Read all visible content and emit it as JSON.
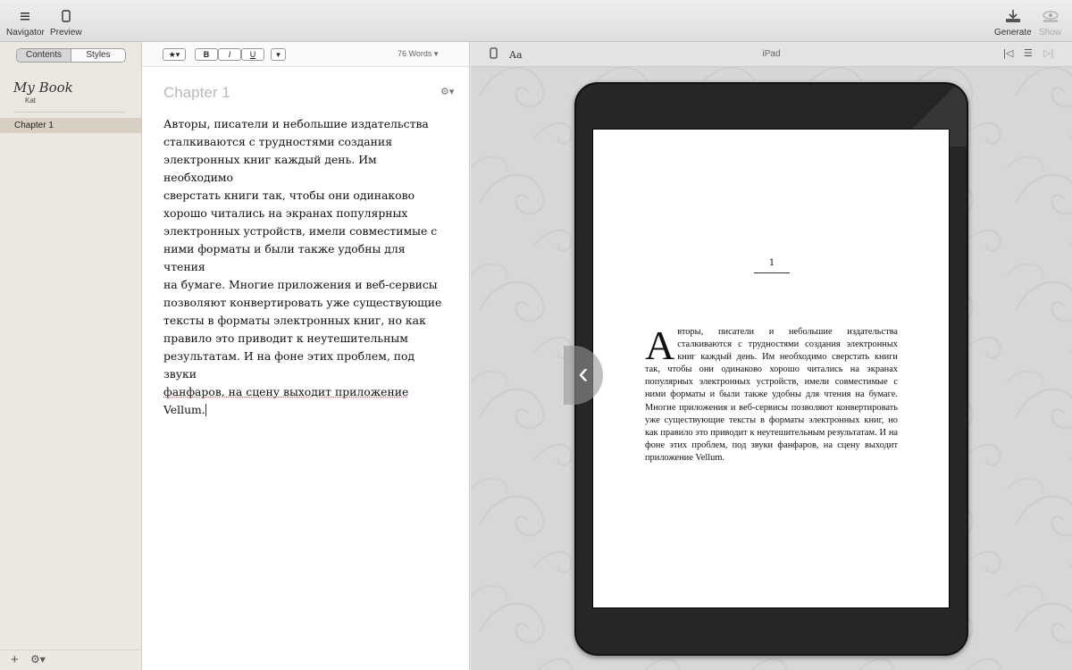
{
  "toolbar": {
    "navigator_label": "Navigator",
    "preview_label": "Preview",
    "generate_label": "Generate",
    "show_label": "Show"
  },
  "sidebar": {
    "tabs": [
      {
        "label": "Contents",
        "active": true
      },
      {
        "label": "Styles",
        "active": false
      }
    ],
    "book_title": "My Book",
    "author": "Kat",
    "chapters": [
      {
        "label": "Chapter 1",
        "selected": true
      }
    ],
    "add_icon": "plus-icon",
    "settings_icon": "gear-icon"
  },
  "editor": {
    "format_buttons": {
      "style": "★",
      "bold": "B",
      "italic": "I",
      "underline": "U",
      "more": "▾"
    },
    "word_count": "76  Words",
    "chapter_title": "Chapter 1",
    "body_lines": [
      "Авторы, писатели и небольшие издательства",
      "сталкиваются с трудностями создания",
      "электронных книг каждый день. Им необходимо",
      "сверстать книги так, чтобы они одинаково",
      "хорошо читались на экранах популярных",
      "электронных устройств, имели совместимые с",
      "ними форматы и были также удобны для чтения",
      "на бумаге. Многие приложения и веб-сервисы",
      "позволяют конвертировать уже существующие",
      "тексты в форматы электронных книг, но как",
      "правило это приводит к неутешительным",
      "результатам. И на фоне этих проблем, под звуки",
      "фанфаров, на сцену выходит приложение",
      "Vellum."
    ]
  },
  "preview": {
    "device_label": "iPad",
    "font_button": "Aa",
    "page_number": "1",
    "drop_cap": "А",
    "page_text": "вторы, писатели и небольшие издательства сталкиваются с трудностями создания электронных книг каждый день. Им необходимо сверстать книги так, чтобы они одинаково хорошо читались на экранах популярных электронных устройств, имели совместимые с ними форматы и были также удобны для чтения на бумаге. Многие приложения и веб-сервисы позволяют конвертировать уже существующие тексты в форматы электронных книг, но как правило это приводит к неутешительным результатам. И на фоне этих проблем, под звуки фанфаров, на сцену выходит приложение Vellum."
  },
  "colors": {
    "sidebar_bg": "#ebe7e1",
    "selected_chapter": "#d8cfc3",
    "preview_bg": "#d7d7d7"
  }
}
